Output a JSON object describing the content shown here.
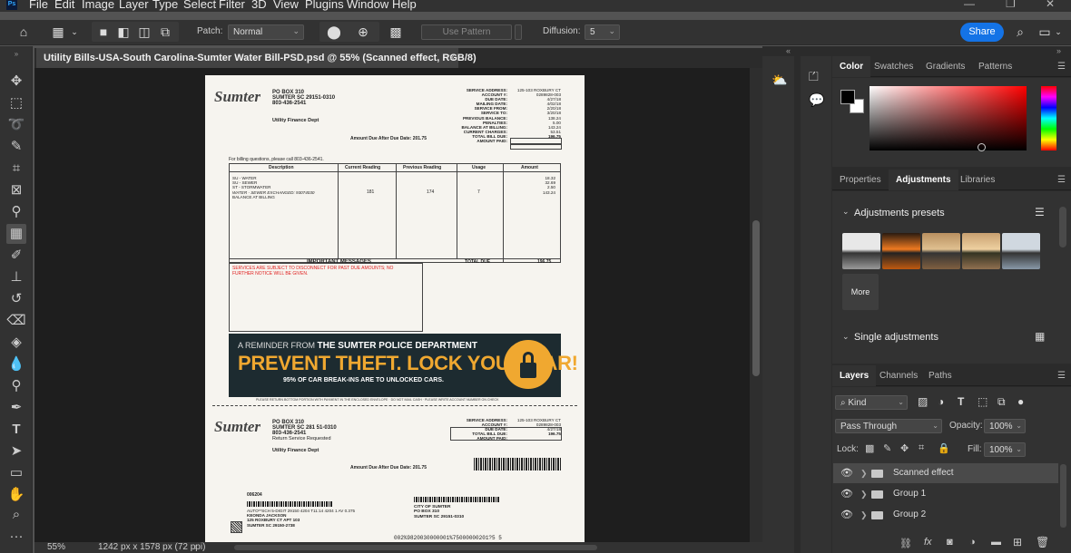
{
  "app": {
    "logo": "Ps"
  },
  "menu": [
    "File",
    "Edit",
    "Image",
    "Layer",
    "Type",
    "Select",
    "Filter",
    "3D",
    "View",
    "Plugins",
    "Window",
    "Help"
  ],
  "options": {
    "patch_label": "Patch:",
    "patch_value": "Normal",
    "use_pattern": "Use Pattern",
    "diffusion_label": "Diffusion:",
    "diffusion_value": "5",
    "share": "Share"
  },
  "document": {
    "tab_title": "Utility Bills-USA-South Carolina-Sumter Water Bill-PSD.psd @ 55% (Scanned effect, RGB/8)",
    "close": "×"
  },
  "status": {
    "zoom": "55%",
    "dimensions": "1242 px x 1578 px (72 ppi)"
  },
  "bill": {
    "logo": "Sumter",
    "address_lines": [
      "PO BOX 310",
      "SUMTER SC 29151-0310",
      "803-436-2541"
    ],
    "dept": "Utility Finance Dept",
    "amount_due_after": "Amount Due After Due Date: 201.75",
    "service_labels": [
      "SERVICE ADDRESS:",
      "ACCOUNT #:",
      "DUE DATE:",
      "MAILING DATE:",
      "SERVICE FROM:",
      "SERVICE TO:",
      "PREVIOUS BALANCE:",
      "PENALTIES:",
      "BALANCE AT BILLING:",
      "CURRENT CHARGES:",
      "TOTAL BILL DUE:",
      "AMOUNT PAID:"
    ],
    "service_values": [
      "125-103 ROXBURY CT",
      "0289828-003",
      "4/27/18",
      "4/02/18",
      "2/20/18",
      "3/20/18",
      "138.24",
      "5.00",
      "143.24",
      "53.51",
      "196.75",
      ""
    ],
    "billing_q": "For billing questions, please call 803-436-2541.",
    "table_headers": [
      "Description",
      "Current Reading",
      "Previous Reading",
      "Usage",
      "Amount"
    ],
    "desc_lines": [
      "SU - WATER",
      "SU - SEWER",
      "ST - STORMWATER",
      "WATER - SEWER EXCHANGED: 93074030",
      "",
      "BALANCE AT BILLING"
    ],
    "current_reading": "181",
    "previous_reading": "174",
    "usage": "7",
    "amounts": [
      "18.32",
      "32.69",
      "2.50",
      "",
      "",
      "143.24"
    ],
    "important": "IMPORTANT MESSAGES",
    "total_due_label": "TOTAL DUE",
    "total_due_value": "196.75",
    "notice": "SERVICES ARE SUBJECT TO DISCONNECT FOR PAST DUE AMOUNTS; NO FURTHER NOTICE WILL BE GIVEN.",
    "banner_top_pre": "A REMINDER FROM",
    "banner_top_dept": "THE SUMTER POLICE DEPARTMENT",
    "banner_main": "PREVENT THEFT. LOCK YOUR CAR!",
    "banner_sub": "95% OF CAR BREAK-INS ARE TO UNLOCKED CARS.",
    "return_note": "PLEASE RETURN BOTTOM PORTION WITH PAYMENT IN THE ENCLOSED ENVELOPE · DO NOT MAIL CASH · PLEASE WRITE ACCOUNT NUMBER ON CHECK",
    "stub_address_lines": [
      "PO BOX 310",
      "SUMTER SC 281 51-0310",
      "803-436-2541",
      "Return Service Requested"
    ],
    "stub_labels": [
      "SERVICE ADDRESS:",
      "ACCOUNT #:",
      "DUE DATE:",
      "TOTAL BILL DUE:",
      "AMOUNT PAID:"
    ],
    "stub_values": [
      "125-103 ROXBURY CT",
      "0289828-003",
      "4/27/18",
      "196.75",
      ""
    ],
    "stub_id": "006204",
    "customer_lines": [
      "AUTO**SCH 5-DIGIT 29150 4204 T11:14    4204 1 AV 0.375",
      "KEONDA JACKSON",
      "125 ROXBURY CT APT 103",
      "SUMTER SC 29150-2738"
    ],
    "city_lines": [
      "CITY OF SUMTER",
      "PO BOX 310",
      "SUMTER SC 29151-0310"
    ],
    "scanline": "002%9820030000001%75000000201?5  5"
  },
  "panels": {
    "color_tabs": [
      "Color",
      "Swatches",
      "Gradients",
      "Patterns"
    ],
    "adj_tabs": [
      "Properties",
      "Adjustments",
      "Libraries"
    ],
    "adj_presets": "Adjustments presets",
    "more": "More",
    "single": "Single adjustments",
    "layer_tabs": [
      "Layers",
      "Channels",
      "Paths"
    ],
    "kind": "Kind",
    "blend": "Pass Through",
    "opacity_label": "Opacity:",
    "opacity": "100%",
    "lock_label": "Lock:",
    "fill_label": "Fill:",
    "fill": "100%",
    "layers": [
      "Scanned effect",
      "Group 1",
      "Group 2"
    ]
  },
  "colors": {
    "accent": "#1473e6",
    "banner_bg": "#1d2b30",
    "banner_text": "#f0a830",
    "notice_red": "#e02020"
  }
}
